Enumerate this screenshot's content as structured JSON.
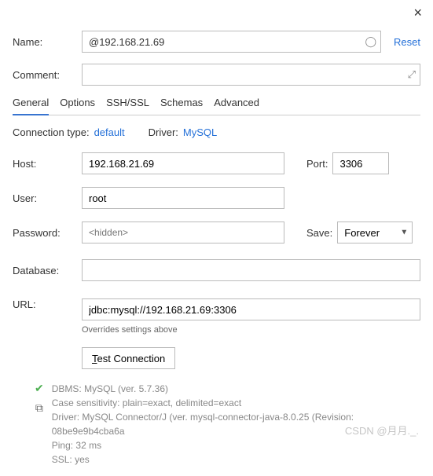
{
  "close_label": "×",
  "name": {
    "label": "Name:",
    "value": "@192.168.21.69",
    "reset": "Reset"
  },
  "comment": {
    "label": "Comment:",
    "value": ""
  },
  "tabs": [
    "General",
    "Options",
    "SSH/SSL",
    "Schemas",
    "Advanced"
  ],
  "connection": {
    "type_label": "Connection type:",
    "type_value": "default",
    "driver_label": "Driver:",
    "driver_value": "MySQL"
  },
  "host": {
    "label": "Host:",
    "value": "192.168.21.69"
  },
  "port": {
    "label": "Port:",
    "value": "3306"
  },
  "user": {
    "label": "User:",
    "value": "root"
  },
  "password": {
    "label": "Password:",
    "placeholder": "<hidden>"
  },
  "save": {
    "label": "Save:",
    "value": "Forever"
  },
  "database": {
    "label": "Database:",
    "value": ""
  },
  "url": {
    "label": "URL:",
    "value": "jdbc:mysql://192.168.21.69:3306",
    "override_note": "Overrides settings above"
  },
  "test_button": "Test Connection",
  "status": {
    "dbms": "DBMS: MySQL (ver. 5.7.36)",
    "case": "Case sensitivity: plain=exact, delimited=exact",
    "driver": "Driver: MySQL Connector/J (ver. mysql-connector-java-8.0.25 (Revision: 08be9e9b4cba6a",
    "ping": "Ping: 32 ms",
    "ssl": "SSL: yes"
  },
  "watermark": "CSDN @月月._."
}
